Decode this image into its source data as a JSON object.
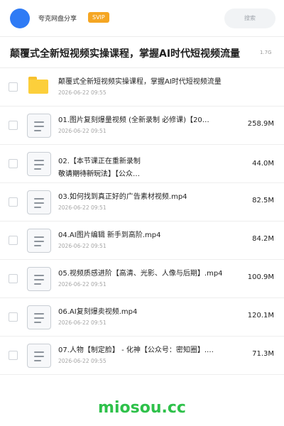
{
  "header": {
    "brand": "夸克网盘分享",
    "badge": "SVIP",
    "search_placeholder": "搜索",
    "avatar_color": "#2f7bf5",
    "badge_color": "#f5a623"
  },
  "folder": {
    "title": "颠覆式全新短视频实操课程，掌握AI时代短视频流量",
    "size": "1.7G"
  },
  "files": [
    {
      "icon": "folder-icon",
      "name": "颠覆式全新短视频实操课程，掌握AI时代短视频流量",
      "date": "2026-06-22 09:55",
      "size": ""
    },
    {
      "icon": "document-icon",
      "name": "01.图片复刻爆量视频 (全新录制 必修课)【20…",
      "date": "2026-06-22 09:51",
      "size": "258.9M"
    },
    {
      "icon": "document-icon",
      "name_line1": "02.【本节课正在重新录制",
      "name_line2": "敬请期待新玩法】【公众…",
      "date": "2026-06-22 09:51",
      "size": "44.0M"
    },
    {
      "icon": "document-icon",
      "name": "03.如何找到真正好的广告素材视频.mp4",
      "date": "2026-06-22 09:51",
      "size": "82.5M"
    },
    {
      "icon": "document-icon",
      "name": "04.AI图片编辑 新手到高阶.mp4",
      "date": "2026-06-22 09:51",
      "size": "84.2M"
    },
    {
      "icon": "document-icon",
      "name": "05.视频质感进阶【高清、光影、人像与后期】.mp4",
      "date": "2026-06-22 09:51",
      "size": "100.9M"
    },
    {
      "icon": "document-icon",
      "name": "06.AI复刻爆卖视频.mp4",
      "date": "2026-06-22 09:51",
      "size": "120.1M"
    },
    {
      "icon": "document-icon",
      "name": "07.人物【制定脸】 - 化神【公众号：密知圈】.…",
      "date": "2026-06-22 09:55",
      "size": "71.3M"
    }
  ],
  "watermark": "miosou.cc",
  "watermark_color": "#2ec14a"
}
